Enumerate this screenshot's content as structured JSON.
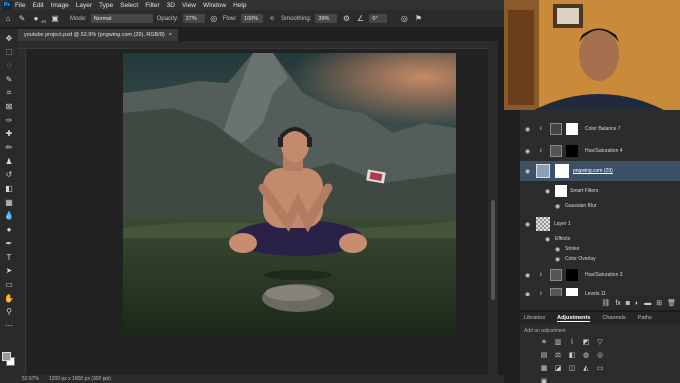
{
  "menu": {
    "logo": "Ps",
    "items": [
      "File",
      "Edit",
      "Image",
      "Layer",
      "Type",
      "Select",
      "Filter",
      "3D",
      "View",
      "Window",
      "Help"
    ]
  },
  "options": {
    "size": "40",
    "mode_label": "Mode:",
    "mode_value": "Normal",
    "opacity_label": "Opacity:",
    "opacity_value": "27%",
    "flow_label": "Flow:",
    "flow_value": "100%",
    "smoothing_label": "Smoothing:",
    "smoothing_value": "39%",
    "angle_value": "0°"
  },
  "document": {
    "tab_title": "youtube project.psd @ 52.9% (pngwing.com (29), RGB/8)",
    "close_glyph": "×"
  },
  "status": {
    "zoom": "52.67%",
    "doc_size": "1200 px x 1800 px (300 ppi)"
  },
  "layers": [
    {
      "name": "Color Balance 7",
      "type": "adjustment"
    },
    {
      "name": "Hue/Saturation 4",
      "type": "adjustment"
    },
    {
      "name": "pngwing.com (29)",
      "type": "smart",
      "selected": true
    },
    {
      "name": "Smart Filters",
      "type": "sub"
    },
    {
      "name": "Gaussian Blur",
      "type": "subsub"
    },
    {
      "name": "Layer 1",
      "type": "pixel"
    },
    {
      "name": "Effects",
      "type": "sub"
    },
    {
      "name": "Stroke",
      "type": "subsub"
    },
    {
      "name": "Color Overlay",
      "type": "subsub"
    },
    {
      "name": "Hue/Saturation 3",
      "type": "adjustment"
    },
    {
      "name": "Levels 11",
      "type": "adjustment"
    }
  ],
  "panel_tabs": [
    "Libraries",
    "Adjustments",
    "Channels",
    "Paths"
  ],
  "active_panel_tab": "Adjustments",
  "adjustments_caption": "Add an adjustment",
  "icons": {
    "eye": "eye-icon",
    "fx": "fx"
  }
}
